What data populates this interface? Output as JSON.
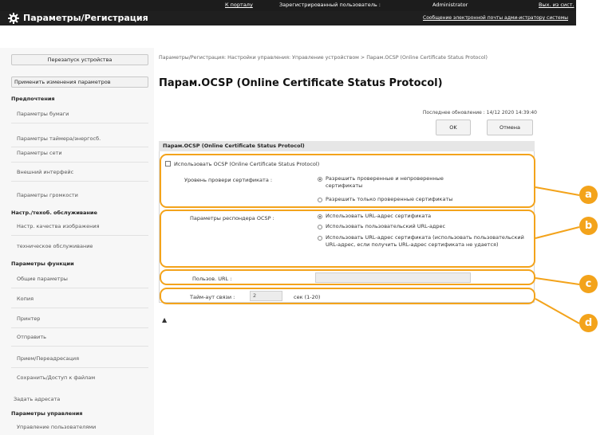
{
  "header": {
    "portal_link": "К порталу",
    "user_label": "Зарегистрированный пользователь :",
    "user_name": "Administrator",
    "logout": "Вых. из сист.",
    "title": "Параметры/Регистрация",
    "admin_msg_link": "Сообщение электронной почты адми-истратору системы"
  },
  "sidebar": {
    "restart_button": "Перезапуск устройства",
    "apply_button": "Применить изменения параметров",
    "items": [
      {
        "label": "Предпочтения",
        "kind": "header"
      },
      {
        "label": "Параметры бумаги",
        "kind": "item"
      },
      {
        "label": "Параметры таймера/энергосб.",
        "kind": "item"
      },
      {
        "label": "Параметры сети",
        "kind": "item"
      },
      {
        "label": "Внешний интерфейс",
        "kind": "item"
      },
      {
        "label": "Параметры громкости",
        "kind": "item"
      },
      {
        "label": "Настр./техоб. обслуживание",
        "kind": "header"
      },
      {
        "label": "Настр. качества изображения",
        "kind": "item"
      },
      {
        "label": "техническое обслуживание",
        "kind": "item"
      },
      {
        "label": "Параметры функции",
        "kind": "header"
      },
      {
        "label": "Общие параметры",
        "kind": "item"
      },
      {
        "label": "Копия",
        "kind": "item"
      },
      {
        "label": "Принтер",
        "kind": "item"
      },
      {
        "label": "Отправить",
        "kind": "item"
      },
      {
        "label": "Прием/Переадресация",
        "kind": "item"
      },
      {
        "label": "Сохранить/Доступ к файлам",
        "kind": "item"
      },
      {
        "label": "Задать адресата",
        "kind": "plain"
      },
      {
        "label": "Параметры управления",
        "kind": "header"
      },
      {
        "label": "Управление пользователями",
        "kind": "item"
      }
    ]
  },
  "main": {
    "breadcrumb": "Параметры/Регистрация: Настройки управления: Управление устройством > Парам.OCSP (Online Certificate Status Protocol)",
    "page_title": "Парам.OCSP (Online Certificate Status Protocol)",
    "last_updated": "Последнее обновление : 14/12 2020 14:39:40",
    "ok_button": "OK",
    "cancel_button": "Отмена",
    "section_title": "Парам.OCSP (Online Certificate Status Protocol)",
    "use_ocsp_label": "Использовать OCSP (Online Certificate Status Protocol)",
    "use_ocsp_checked": false,
    "cert_level_label": "Уровень провери сертификата :",
    "cert_level_options": [
      {
        "label": "Разрешить проверенные и непроверенные сертификаты",
        "selected": true
      },
      {
        "label": "Разрешить только проверенные сертификаты",
        "selected": false
      }
    ],
    "responder_label": "Параметры респондера OCSP :",
    "responder_options": [
      {
        "label": "Использовать URL-адрес сертификата",
        "selected": true
      },
      {
        "label": "Использовать пользовательский URL-адрес",
        "selected": false
      },
      {
        "label": "Использовать URL-адрес сертификата (использовать пользовательский URL-адрес, если получить URL-адрес сертификата не удается)",
        "selected": false
      }
    ],
    "custom_url_label": "Пользов. URL :",
    "custom_url_value": "",
    "timeout_label": "Тайм-аут связи :",
    "timeout_value": "2",
    "timeout_unit": "сек (1-20)",
    "back_to_top": "▲"
  },
  "callouts": [
    "a",
    "b",
    "c",
    "d"
  ],
  "colors": {
    "accent": "#f3a31b",
    "header_bg": "#1f1f1f"
  }
}
